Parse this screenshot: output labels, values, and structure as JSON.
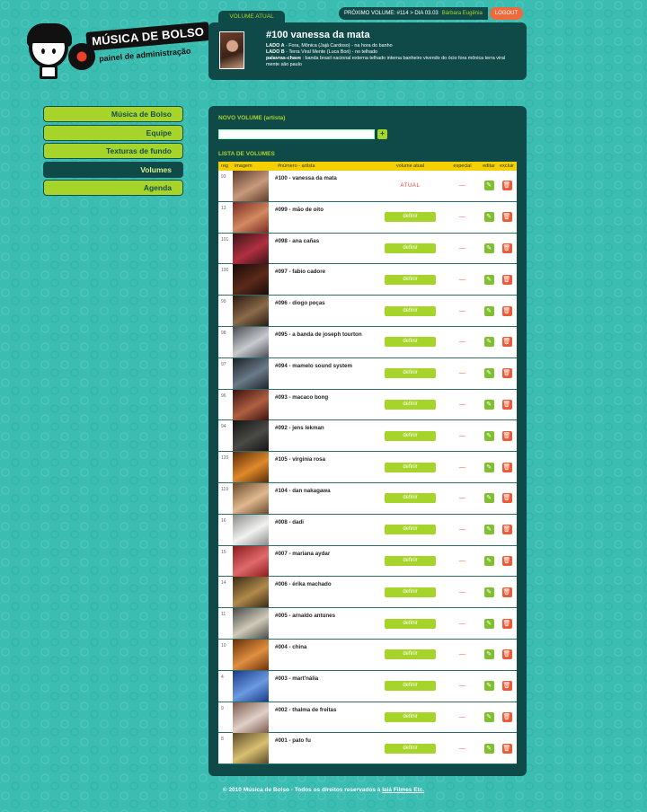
{
  "logo": {
    "title": "MÚSICA DE BOLSO",
    "subtitle": "painel de administração"
  },
  "nav": [
    {
      "label": "Música de Bolso",
      "active": false
    },
    {
      "label": "Equipe",
      "active": false
    },
    {
      "label": "Texturas de fundo",
      "active": false
    },
    {
      "label": "Volumes",
      "active": true
    },
    {
      "label": "Agenda",
      "active": false
    }
  ],
  "topbar": {
    "next_volume": "PRÓXIMO VOLUME: #114 > DIA 03.03",
    "user": "Bárbara Eugênia",
    "logout": "LOGOUT"
  },
  "current": {
    "tab": "VOLUME ATUAL",
    "title": "#100  vanessa da mata",
    "lado_a_label": "LADO A",
    "lado_a": " - Fora, Mônica (Jajá Cardoso) - na hora do banho",
    "lado_b_label": "LADO B",
    "lado_b": " - Terra Viral Mente (Luca Bori) - no telhado",
    "keywords_label": "palavras-chave",
    "keywords": " : banda brasil nacional externa telhado interna banheiro vivendo do ócio fora mônica terra viral mente são paulo"
  },
  "main": {
    "new_label": "NOVO VOLUME (artista)",
    "new_button": "+",
    "list_label": "LISTA DE VOLUMES",
    "headers": {
      "reg": "reg",
      "img": "imagem",
      "name": "#número - artista",
      "cur": "volume atual",
      "esp": "especial",
      "edit": "editar",
      "del": "excluir"
    },
    "define_label": "definir",
    "current_label": "ATUAL",
    "special_mark": "—",
    "edit_icon": "✎",
    "delete_icon": "🗑"
  },
  "rows": [
    {
      "reg": "93",
      "name": "#100 - vanessa da mata",
      "current": true,
      "c1": "#5e3b2a",
      "c2": "#c89a7c"
    },
    {
      "reg": "13",
      "name": "#099 - mão de oito",
      "current": false,
      "c1": "#7a2a22",
      "c2": "#d28a60"
    },
    {
      "reg": "101",
      "name": "#098 - ana cañas",
      "current": false,
      "c1": "#3a1216",
      "c2": "#b03040"
    },
    {
      "reg": "100",
      "name": "#097 - fabio cadore",
      "current": false,
      "c1": "#1a0a08",
      "c2": "#5a2a1a"
    },
    {
      "reg": "99",
      "name": "#096 - diogo poças",
      "current": false,
      "c1": "#2a1a12",
      "c2": "#8a6a4a"
    },
    {
      "reg": "98",
      "name": "#095 - a banda de joseph tourton",
      "current": false,
      "c1": "#4a4e52",
      "c2": "#c8cace"
    },
    {
      "reg": "97",
      "name": "#094 - mamelo sound system",
      "current": false,
      "c1": "#1c2228",
      "c2": "#6a7a88"
    },
    {
      "reg": "96",
      "name": "#093 - macaco bong",
      "current": false,
      "c1": "#3a1210",
      "c2": "#b06040"
    },
    {
      "reg": "94",
      "name": "#092 - jens lekman",
      "current": false,
      "c1": "#141414",
      "c2": "#4a4a46"
    },
    {
      "reg": "120",
      "name": "#105 - virginia rosa",
      "current": false,
      "c1": "#5a2a0a",
      "c2": "#e08a2a"
    },
    {
      "reg": "119",
      "name": "#104 - dan nakagawa",
      "current": false,
      "c1": "#6a4a2a",
      "c2": "#e0b890"
    },
    {
      "reg": "16",
      "name": "#008 - dadi",
      "current": false,
      "c1": "#8a8a8a",
      "c2": "#f2f2f0"
    },
    {
      "reg": "15",
      "name": "#007 - mariana aydar",
      "current": false,
      "c1": "#8a1a20",
      "c2": "#e06a6a"
    },
    {
      "reg": "14",
      "name": "#006 - érika machado",
      "current": false,
      "c1": "#3a2a14",
      "c2": "#b08a4a"
    },
    {
      "reg": "11",
      "name": "#005 - arnaldo antunes",
      "current": false,
      "c1": "#4a4a48",
      "c2": "#d0cab8"
    },
    {
      "reg": "10",
      "name": "#004 - china",
      "current": false,
      "c1": "#6a3008",
      "c2": "#e09040"
    },
    {
      "reg": "4",
      "name": "#003 - mart'nália",
      "current": false,
      "c1": "#1a3a8a",
      "c2": "#6a9ae0"
    },
    {
      "reg": "9",
      "name": "#002 - thalma de freitas",
      "current": false,
      "c1": "#7a5a4a",
      "c2": "#e0d0c8"
    },
    {
      "reg": "8",
      "name": "#001 - pato fu",
      "current": false,
      "c1": "#5a4a2a",
      "c2": "#d8c070"
    }
  ],
  "footer": {
    "text": "© 2010 Música de Bolso - Todos os direitos reservados à ",
    "link": "Iaiá Filmes Etc."
  },
  "colors": {
    "background": "#3bbdb2",
    "panel": "#0f4a49",
    "accent": "#a6d42b",
    "header": "#f4d000",
    "danger": "#ea5b3a"
  }
}
